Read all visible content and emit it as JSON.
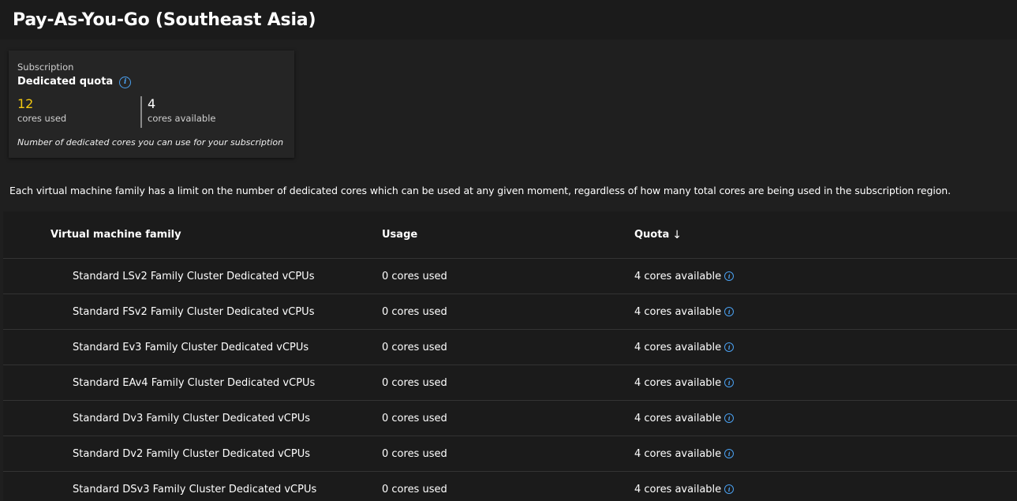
{
  "header": {
    "title": "Pay-As-You-Go (Southeast Asia)"
  },
  "quota_card": {
    "kicker": "Subscription",
    "heading": "Dedicated quota",
    "used_value": "12",
    "used_label": "cores used",
    "available_value": "4",
    "available_label": "cores available",
    "note": "Number of dedicated cores you can use for your subscription"
  },
  "description": "Each virtual machine family has a limit on the number of dedicated cores which can be used at any given moment, regardless of how many total cores are being used in the subscription region.",
  "table": {
    "columns": {
      "family": "Virtual machine family",
      "usage": "Usage",
      "quota": "Quota"
    },
    "sort_indicator": "↓",
    "rows": [
      {
        "family": "Standard LSv2 Family Cluster Dedicated vCPUs",
        "usage": "0 cores used",
        "quota": "4 cores available"
      },
      {
        "family": "Standard FSv2 Family Cluster Dedicated vCPUs",
        "usage": "0 cores used",
        "quota": "4 cores available"
      },
      {
        "family": "Standard Ev3 Family Cluster Dedicated vCPUs",
        "usage": "0 cores used",
        "quota": "4 cores available"
      },
      {
        "family": "Standard EAv4 Family Cluster Dedicated vCPUs",
        "usage": "0 cores used",
        "quota": "4 cores available"
      },
      {
        "family": "Standard Dv3 Family Cluster Dedicated vCPUs",
        "usage": "0 cores used",
        "quota": "4 cores available"
      },
      {
        "family": "Standard Dv2 Family Cluster Dedicated vCPUs",
        "usage": "0 cores used",
        "quota": "4 cores available"
      },
      {
        "family": "Standard DSv3 Family Cluster Dedicated vCPUs",
        "usage": "0 cores used",
        "quota": "4 cores available"
      }
    ]
  },
  "icons": {
    "info": "info-icon",
    "sort": "sort-descending-icon"
  },
  "colors": {
    "accent_used": "#f2c811",
    "info_blue": "#4aa0f0",
    "background": "#1f1f1f"
  }
}
